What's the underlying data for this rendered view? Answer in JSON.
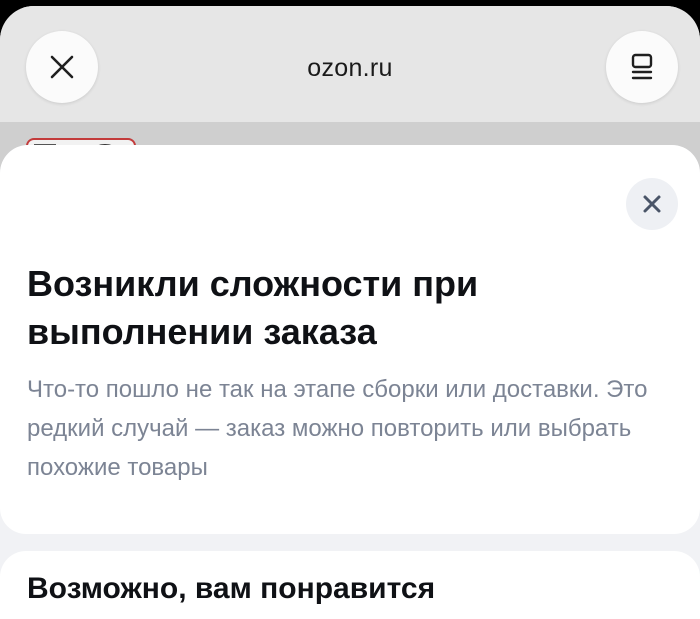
{
  "browser": {
    "url": "ozon.ru",
    "close_icon": "close-icon",
    "tabs_icon": "tabs-icon"
  },
  "sheet": {
    "title": "Возникли сложности при выполнении заказа",
    "description": "Что-то пошло не так на этапе сборки или доставки. Это редкий случай — заказ можно повторить или выбрать похожие товары",
    "close_icon": "close-icon"
  },
  "recommendations": {
    "title": "Возможно, вам понравится"
  },
  "colors": {
    "title_text": "#0f1115",
    "description_text": "#7c8494",
    "close_button_bg": "#eef0f4"
  }
}
